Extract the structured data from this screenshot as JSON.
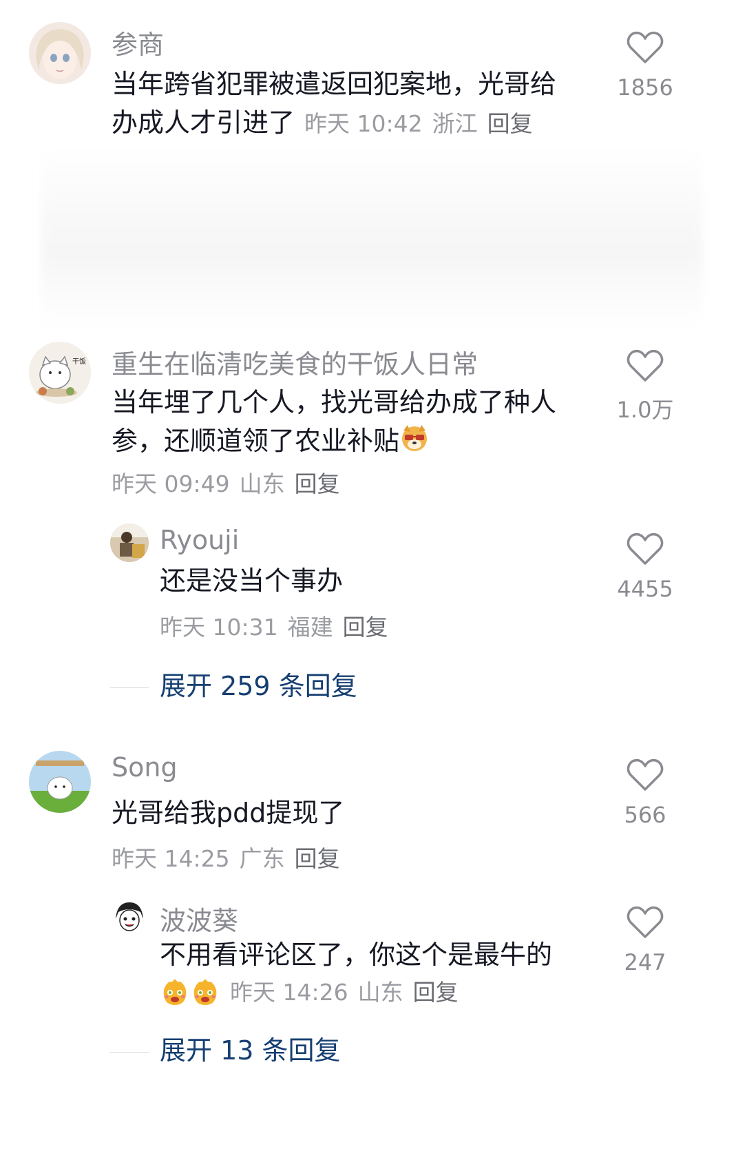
{
  "comments": [
    {
      "username": "参商",
      "text_line1": "当年跨省犯罪被遣返回犯案地，光哥给",
      "text_line2": "办成人才引进了",
      "time": "昨天 10:42",
      "location": "浙江",
      "reply_label": "回复",
      "likes": "1856",
      "avatar_icon": "anime-girl-avatar"
    },
    {
      "username": "重生在临清吃美食的干饭人日常",
      "text_line1": "当年埋了几个人，找光哥给办成了种人",
      "text_line2": "参，还顺道领了农业补贴",
      "time": "昨天 09:49",
      "location": "山东",
      "reply_label": "回复",
      "likes": "1.0万",
      "avatar_icon": "cat-eating-avatar",
      "avatar_caption": "干饭",
      "emoji": "doge-sunglasses-emoji",
      "sub": {
        "username": "Ryouji",
        "text": "还是没当个事办",
        "time": "昨天 10:31",
        "location": "福建",
        "reply_label": "回复",
        "likes": "4455",
        "avatar_icon": "person-room-avatar"
      },
      "expand_label": "展开 259 条回复"
    },
    {
      "username": "Song",
      "text": "光哥给我pdd提现了",
      "time": "昨天 14:25",
      "location": "广东",
      "reply_label": "回复",
      "likes": "566",
      "avatar_icon": "white-dog-avatar",
      "sub": {
        "username": "波波葵",
        "text": "不用看评论区了，你这个是最牛的",
        "time": "昨天 14:26",
        "location": "山东",
        "reply_label": "回复",
        "likes": "247",
        "avatar_icon": "anime-boy-avatar",
        "emoji": "laughing-tears-emoji"
      },
      "expand_label": "展开 13 条回复"
    }
  ],
  "colors": {
    "text": "#161823",
    "username": "#8a8b91",
    "meta": "#9b9ca1",
    "expand": "#163f72"
  }
}
